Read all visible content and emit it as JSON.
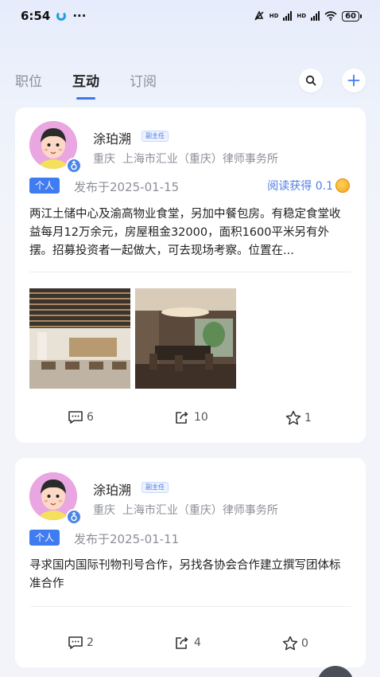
{
  "status": {
    "time": "6:54",
    "more": "···",
    "battery": "60",
    "net1": "HD",
    "net2": "HD"
  },
  "tabs": [
    {
      "label": "职位"
    },
    {
      "label": "互动"
    },
    {
      "label": "订阅"
    }
  ],
  "active_tab": "互动",
  "colors": {
    "accent": "#3f7cf2",
    "reward": "#4f7fe6",
    "avatar_bg": "#e9a6e0"
  },
  "posts": [
    {
      "author": "涂珀溯",
      "title_badge": "副主任",
      "location": "重庆",
      "org": "上海市汇业（重庆）律师事务所",
      "tag": "个人",
      "date": "发布于2025-01-15",
      "reward": "阅读获得 0.1",
      "content": "两江土储中心及渝高物业食堂，另加中餐包房。有稳定食堂收益每月12万余元，房屋租金32000，面积1600平米另有外摆。招募投资者一起做大，可去现场考察。位置在...",
      "photos": [
        "canteen-photo",
        "private-room-photo"
      ],
      "comments": "6",
      "shares": "10",
      "likes": "1"
    },
    {
      "author": "涂珀溯",
      "title_badge": "副主任",
      "location": "重庆",
      "org": "上海市汇业（重庆）律师事务所",
      "tag": "个人",
      "date": "发布于2025-01-11",
      "content": "寻求国内国际刊物刊号合作，另找各协会合作建立撰写团体标准合作",
      "comments": "2",
      "shares": "4",
      "likes": "0"
    }
  ],
  "icons": [
    "search-icon",
    "plus-icon",
    "comment-icon",
    "share-icon",
    "star-icon",
    "male-icon",
    "coin-icon"
  ]
}
